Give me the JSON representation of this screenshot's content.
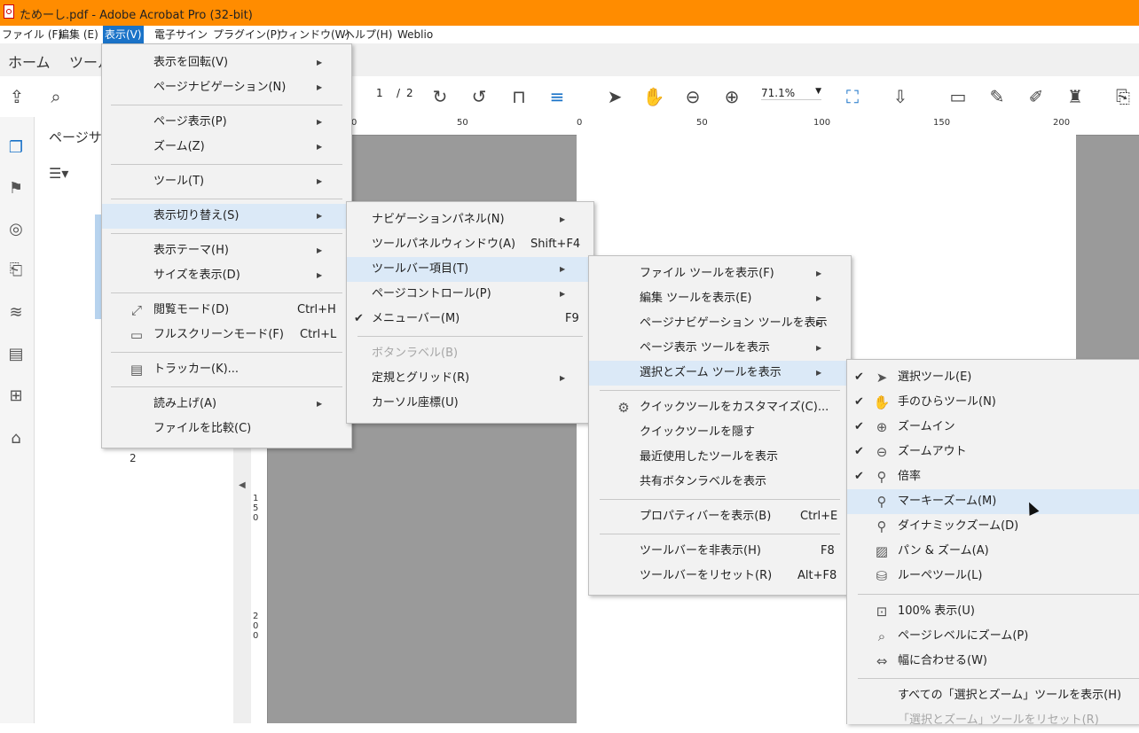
{
  "window": {
    "title": "ためーし.pdf - Adobe Acrobat Pro (32-bit)"
  },
  "menubar": [
    {
      "label": "ファイル (F)"
    },
    {
      "label": "編集 (E)"
    },
    {
      "label": "表示(V)"
    },
    {
      "label": "電子サイン"
    },
    {
      "label": "プラグイン(P)"
    },
    {
      "label": "ウィンドウ(W)"
    },
    {
      "label": "ヘルプ(H)"
    },
    {
      "label": "Weblio"
    }
  ],
  "tabs": [
    {
      "label": "ホーム"
    },
    {
      "label": "ツール"
    }
  ],
  "toolbar": {
    "page_current": "1",
    "page_sep": "/",
    "page_total": "2",
    "zoom": "71.1%",
    "icons": [
      "cloud-upload-icon",
      "search-icon",
      "rotate-cw-icon",
      "rotate-ccw-icon",
      "fit-page-icon",
      "scroll-icon",
      "select-arrow-icon",
      "hand-icon",
      "zoom-out-icon",
      "zoom-in-icon",
      "marquee-zoom-icon",
      "scroll-down-icon",
      "comment-icon",
      "highlight-icon",
      "edit-icon",
      "stamp-icon",
      "export-icon"
    ]
  },
  "thumbpanel": {
    "title": "ページサム",
    "page_number": "2"
  },
  "ruler": {
    "h_labels": [
      "0",
      "50",
      "0",
      "50",
      "100",
      "150",
      "200"
    ],
    "v_labels": [
      "150",
      "200"
    ]
  },
  "menu_view": {
    "items": [
      {
        "label": "表示を回転(V)"
      },
      {
        "label": "ページナビゲーション(N)"
      },
      {
        "label": "ページ表示(P)"
      },
      {
        "label": "ズーム(Z)"
      },
      {
        "label": "ツール(T)"
      },
      {
        "label": "表示切り替え(S)"
      },
      {
        "label": "表示テーマ(H)"
      },
      {
        "label": "サイズを表示(D)"
      },
      {
        "label": "閲覧モード(D)",
        "shortcut": "Ctrl+H"
      },
      {
        "label": "フルスクリーンモード(F)",
        "shortcut": "Ctrl+L"
      },
      {
        "label": "トラッカー(K)..."
      },
      {
        "label": "読み上げ(A)"
      },
      {
        "label": "ファイルを比較(C)"
      }
    ]
  },
  "menu_toggle": {
    "items": [
      {
        "label": "ナビゲーションパネル(N)"
      },
      {
        "label": "ツールパネルウィンドウ(A)",
        "shortcut": "Shift+F4"
      },
      {
        "label": "ツールバー項目(T)"
      },
      {
        "label": "ページコントロール(P)"
      },
      {
        "label": "メニューバー(M)",
        "shortcut": "F9"
      },
      {
        "label": "ボタンラベル(B)"
      },
      {
        "label": "定規とグリッド(R)"
      },
      {
        "label": "カーソル座標(U)"
      }
    ]
  },
  "menu_toolbar_items": {
    "items": [
      {
        "label": "ファイル ツールを表示(F)"
      },
      {
        "label": "編集 ツールを表示(E)"
      },
      {
        "label": "ページナビゲーション ツールを表示"
      },
      {
        "label": "ページ表示 ツールを表示"
      },
      {
        "label": "選択とズーム ツールを表示"
      },
      {
        "label": "クイックツールをカスタマイズ(C)..."
      },
      {
        "label": "クイックツールを隠す"
      },
      {
        "label": "最近使用したツールを表示"
      },
      {
        "label": "共有ボタンラベルを表示"
      },
      {
        "label": "プロパティバーを表示(B)",
        "shortcut": "Ctrl+E"
      },
      {
        "label": "ツールバーを非表示(H)",
        "shortcut": "F8"
      },
      {
        "label": "ツールバーをリセット(R)",
        "shortcut": "Alt+F8"
      }
    ]
  },
  "menu_select_zoom": {
    "items": [
      {
        "label": "選択ツール(E)"
      },
      {
        "label": "手のひらツール(N)"
      },
      {
        "label": "ズームイン"
      },
      {
        "label": "ズームアウト"
      },
      {
        "label": "倍率"
      },
      {
        "label": "マーキーズーム(M)"
      },
      {
        "label": "ダイナミックズーム(D)"
      },
      {
        "label": "パン & ズーム(A)"
      },
      {
        "label": "ルーペツール(L)"
      },
      {
        "label": "100% 表示(U)"
      },
      {
        "label": "ページレベルにズーム(P)"
      },
      {
        "label": "幅に合わせる(W)"
      },
      {
        "label": "すべての「選択とズーム」ツールを表示(H)"
      },
      {
        "label": "「選択とズーム」ツールをリセット(R)"
      }
    ]
  },
  "colors": {
    "titlebar": "#ff8c00",
    "menu_active": "#1a73c8",
    "menu_highlight": "#dbe9f7",
    "doc_bg": "#9a9a9a"
  }
}
